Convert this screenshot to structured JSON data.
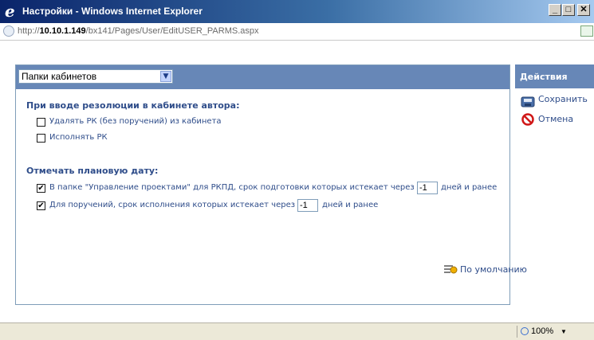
{
  "window": {
    "title": "Настройки - Windows Internet Explorer",
    "minimize": "_",
    "maximize": "□",
    "close": "✕"
  },
  "address": {
    "prefix": "http://",
    "host": "10.10.1.149",
    "path": "/bx141/Pages/User/EditUSER_PARMS.aspx"
  },
  "settings": {
    "folder_select": "Папки кабинетов",
    "section1_title": "При вводе резолюции в кабинете автора:",
    "opt_delete": "Удалять РК (без поручений) из кабинета",
    "opt_execute": "Исполнять РК",
    "section2_title": "Отмечать плановую дату:",
    "opt_projects": "В папке \"Управление проектами\" для РКПД, срок подготовки которых истекает через",
    "opt_projects_days": "-1",
    "opt_projects_suffix": "дней и ранее",
    "opt_tasks": "Для поручений, срок исполнения которых истекает через",
    "opt_tasks_days": "-1",
    "opt_tasks_suffix": "дней и ранее",
    "default_link": "По умолчанию",
    "checks": {
      "delete": false,
      "execute": false,
      "projects": true,
      "tasks": true
    }
  },
  "actions": {
    "title": "Действия",
    "save": "Сохранить",
    "cancel": "Отмена"
  },
  "status": {
    "zoom": "100%"
  },
  "colors": {
    "header_blue": "#6787b7",
    "label_blue": "#2f4d8a",
    "cancel_red": "#d01818"
  }
}
